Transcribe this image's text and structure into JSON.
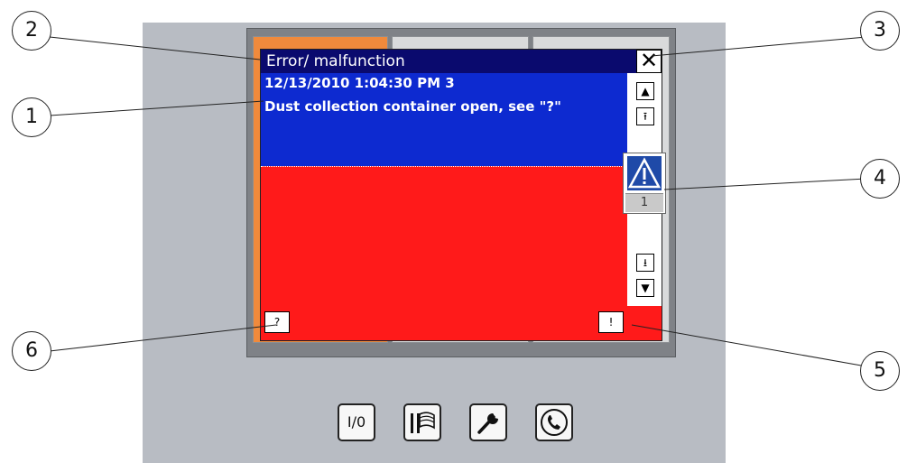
{
  "dialog": {
    "title": "Error/ malfunction",
    "close_glyph": "✕",
    "timestamp_line": "12/13/2010 1:04:30 PM 3",
    "message_line": "Dust collection container open, see \"?\"",
    "help_label": "?",
    "ack_label": "!",
    "message_count": "1",
    "colors": {
      "title_bar": "#0a0a6e",
      "message_bg": "#0d2ad0",
      "alarm_bg": "#ff1a1a"
    }
  },
  "scrollbar": {
    "up": "▲",
    "page_up": "⭱",
    "page_down": "⭳",
    "down": "▼"
  },
  "callouts": [
    "1",
    "2",
    "3",
    "4",
    "5",
    "6"
  ],
  "function_keys": {
    "io_label": "I/0"
  },
  "icons": [
    "warning-triangle-icon",
    "flags-icon",
    "wrench-icon",
    "phone-icon"
  ]
}
